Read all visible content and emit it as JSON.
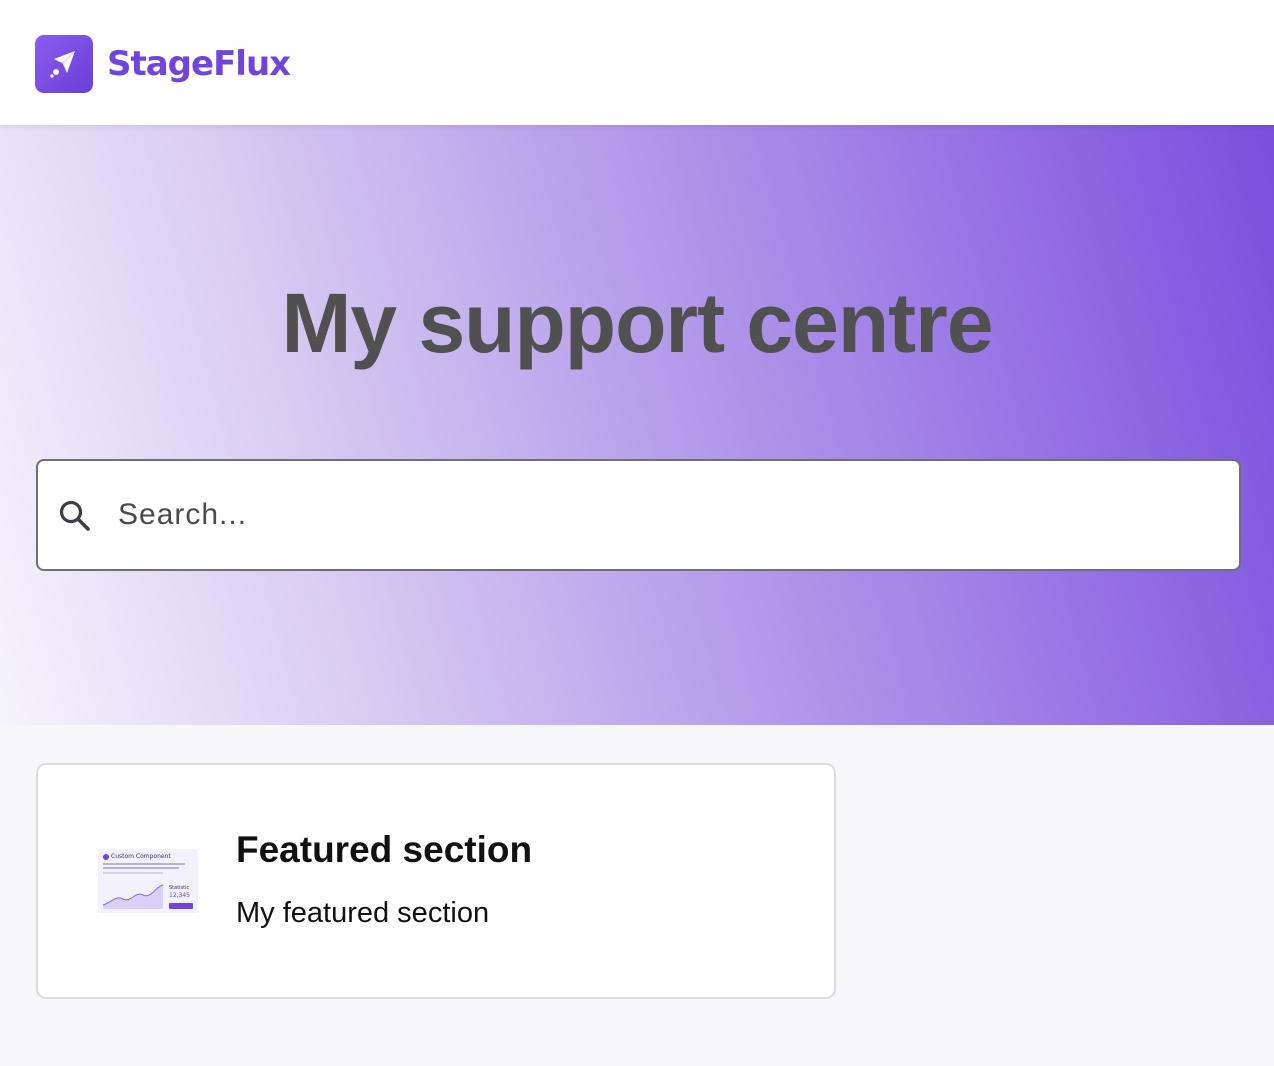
{
  "header": {
    "brand_name": "StageFlux",
    "logo_icon": "rocket-icon"
  },
  "hero": {
    "title": "My support centre"
  },
  "search": {
    "placeholder": "Search...",
    "value": "",
    "icon": "search-icon"
  },
  "featured": {
    "title": "Featured section",
    "description": "My featured section",
    "thumbnail": {
      "title": "Custom Component",
      "stat_label": "Statistic",
      "stat_value": "12,345"
    }
  },
  "colors": {
    "brand": "#7145db",
    "hero_gradient_start": "#f6f4fb",
    "hero_gradient_end": "#7a4fde",
    "title_text": "#505050"
  }
}
